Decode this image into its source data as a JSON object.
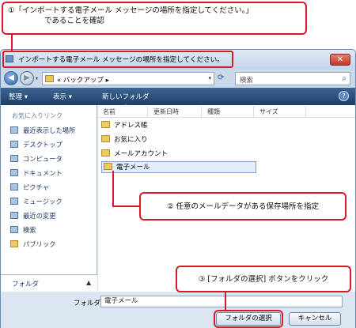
{
  "callouts": {
    "step1_line1": "①「インポートする電子メール メッセージの場所を指定してください。」",
    "step1_line2": "であることを確認",
    "step2": "② 任意のメールデータがある保存場所を指定",
    "step3": "③ [フォルダの選択] ボタンをクリック"
  },
  "window": {
    "title": "インポートする電子メール メッセージの場所を指定してください。",
    "close_glyph": "✕"
  },
  "nav": {
    "address": "« バックアップ ▸",
    "search_placeholder": "検索"
  },
  "toolbar": {
    "organize": "整理 ▾",
    "view": "表示 ▾",
    "new_folder": "新しいフォルダ"
  },
  "sidebar": {
    "header": "お気に入りリンク",
    "items": [
      "最近表示した場所",
      "デスクトップ",
      "コンピュータ",
      "ドキュメント",
      "ピクチャ",
      "ミュージック",
      "最近の変更",
      "検索",
      "パブリック"
    ],
    "footer": "フォルダ"
  },
  "columns": [
    "名前",
    "更新日時",
    "種類",
    "サイズ"
  ],
  "files": [
    "アドレス帳",
    "お気に入り",
    "メールアカウント",
    "電子メール"
  ],
  "bottom": {
    "folder_label": "フォルダ:",
    "folder_value": "電子メール",
    "select_button": "フォルダの選択",
    "cancel_button": "キャンセル"
  },
  "colors": {
    "callout_border": "#d9192a",
    "toolbar": "#2a4f7f"
  }
}
